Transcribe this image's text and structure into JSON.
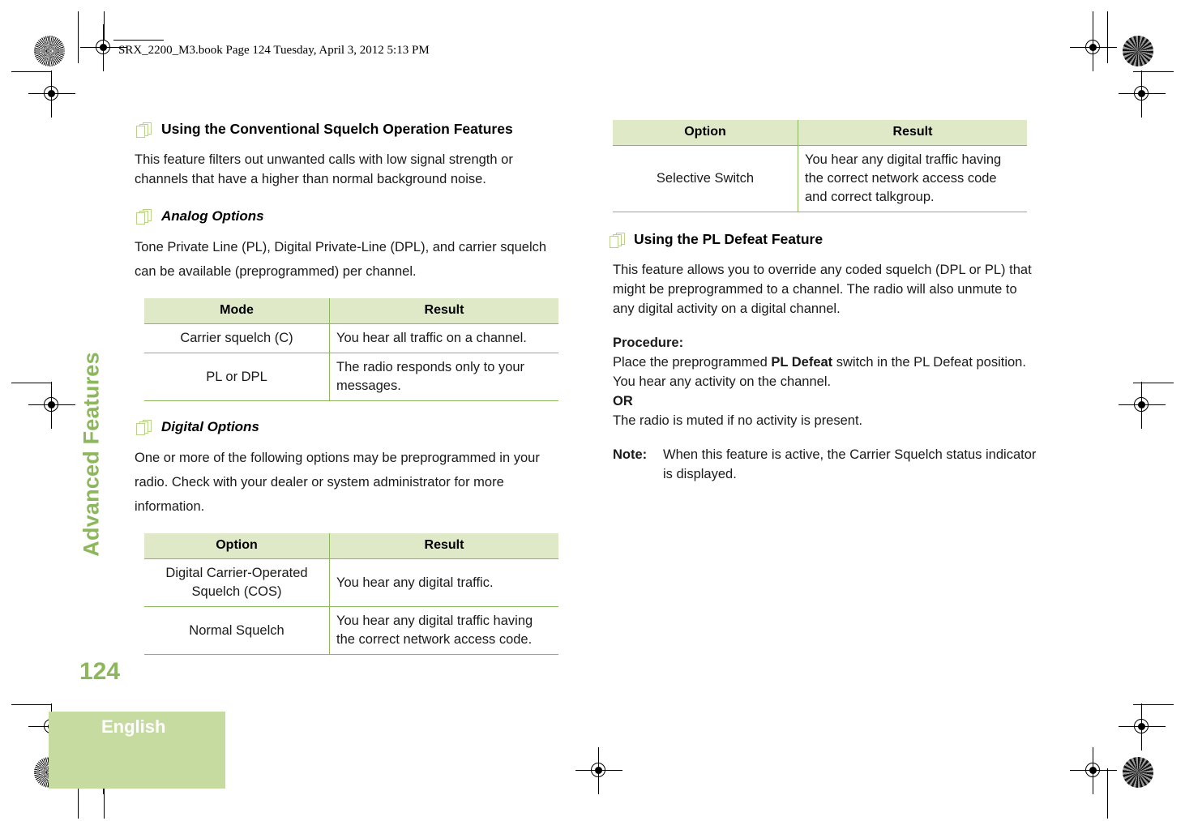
{
  "file_header": "SRX_2200_M3.book  Page 124  Tuesday, April 3, 2012  5:13 PM",
  "sidebar": {
    "chapter": "Advanced Features",
    "page_number": "124",
    "language_tab": "English"
  },
  "colors": {
    "accent_green": "#8cb75c",
    "table_header_green": "#dfe9c8",
    "tab_green": "#c6dba0",
    "icon_green": "#b9d189"
  },
  "left_column": {
    "heading_1": {
      "icon": "pages-stack-icon",
      "text": "Using the Conventional Squelch Operation Features"
    },
    "paragraph_1": "This feature filters out unwanted calls with low signal strength or channels that have a higher than normal background noise.",
    "heading_2": {
      "icon": "pages-stack-icon",
      "text": "Analog Options"
    },
    "paragraph_2": "Tone Private Line (PL), Digital Private-Line (DPL), and carrier squelch can be available (preprogrammed) per channel.",
    "table_1": {
      "headers": [
        "Mode",
        "Result"
      ],
      "rows": [
        [
          "Carrier squelch (C)",
          "You hear all traffic on a channel."
        ],
        [
          "PL or DPL",
          "The radio responds only to your messages."
        ]
      ]
    },
    "heading_3": {
      "icon": "pages-stack-icon",
      "text": "Digital Options"
    },
    "paragraph_3": "One or more of the following options may be preprogrammed in your radio. Check with your dealer or system administrator for more information.",
    "table_2": {
      "headers": [
        "Option",
        "Result"
      ],
      "rows": [
        [
          "Digital Carrier-Operated Squelch (COS)",
          "You hear any digital traffic."
        ],
        [
          "Normal Squelch",
          "You hear any digital traffic having the correct network access code."
        ]
      ]
    }
  },
  "right_column": {
    "table_1": {
      "headers": [
        "Option",
        "Result"
      ],
      "rows": [
        [
          "Selective Switch",
          "You hear any digital traffic having the correct network access code and correct talkgroup."
        ]
      ]
    },
    "heading_1": {
      "icon": "pages-stack-icon",
      "text": "Using the PL Defeat Feature"
    },
    "paragraph_1": "This feature allows you to override any coded squelch (DPL or PL) that might be preprogrammed to a channel. The radio will also unmute to any digital activity on a digital channel.",
    "procedure_label": "Procedure:",
    "procedure_text_before": "Place the preprogrammed ",
    "procedure_bold": "PL Defeat",
    "procedure_text_after": " switch in the PL Defeat position. You hear any activity on the channel.",
    "or_label": "OR",
    "or_text": "The radio is muted if no activity is present.",
    "note_label": "Note:",
    "note_text": "When this feature is active, the Carrier Squelch status indicator is displayed."
  }
}
